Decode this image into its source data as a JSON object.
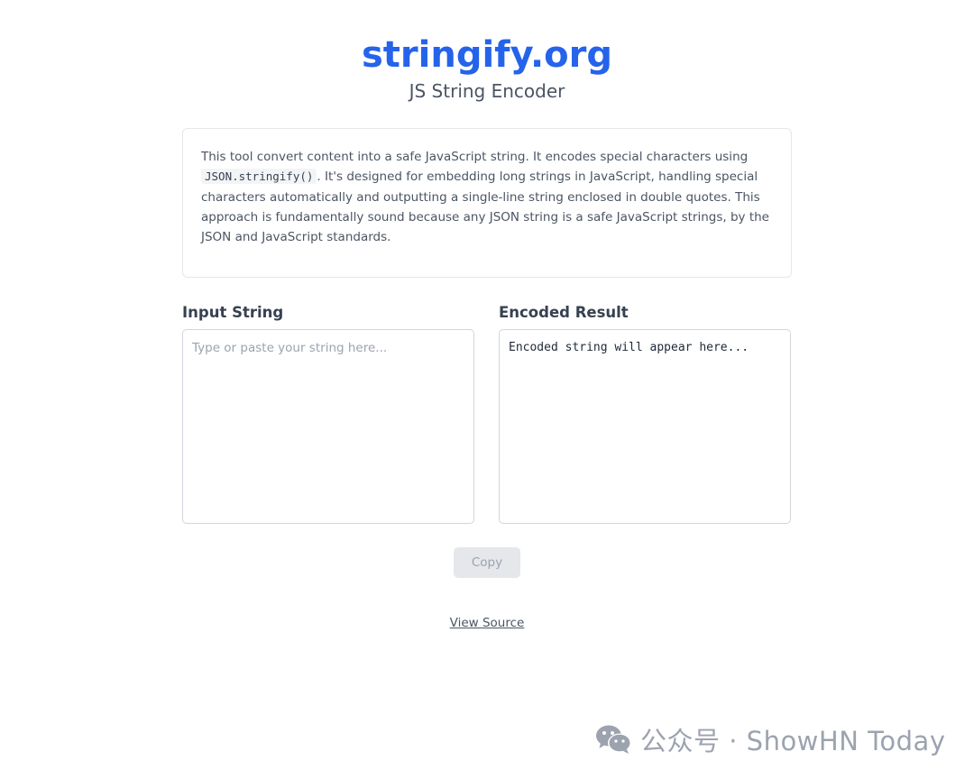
{
  "header": {
    "title": "stringify.org",
    "subtitle": "JS String Encoder"
  },
  "intro": {
    "text_before": "This tool convert content into a safe JavaScript string. It encodes special characters using ",
    "code": "JSON.stringify()",
    "text_after": ". It's designed for embedding long strings in JavaScript, handling special characters automatically and outputting a single-line string enclosed in double quotes. This approach is fundamentally sound because any JSON string is a safe JavaScript strings, by the JSON and JavaScript standards."
  },
  "input": {
    "label": "Input String",
    "placeholder": "Type or paste your string here...",
    "value": ""
  },
  "output": {
    "label": "Encoded Result",
    "value": "Encoded string will appear here..."
  },
  "actions": {
    "copy_label": "Copy",
    "copy_enabled": false
  },
  "footer": {
    "view_source_label": "View Source"
  },
  "watermark": {
    "icon": "wechat-icon",
    "text": "公众号 · ShowHN Today"
  },
  "colors": {
    "accent": "#2563eb",
    "text_muted": "#4b5563",
    "border": "#d1d5db",
    "button_disabled_bg": "#e5e7eb",
    "button_disabled_text": "#9ca3af"
  }
}
